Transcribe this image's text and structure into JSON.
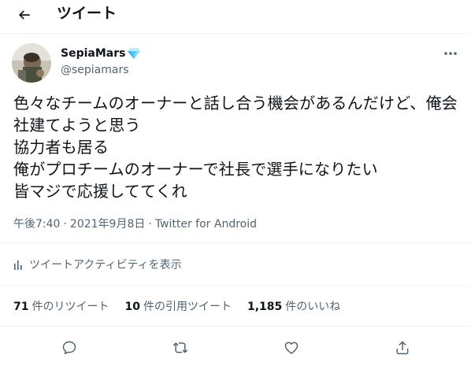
{
  "header": {
    "title": "ツイート",
    "back_icon": "arrow-left-icon"
  },
  "author": {
    "name": "SepiaMars",
    "verified_badge_icon": "diamond-icon",
    "handle": "@sepiamars"
  },
  "tweet": {
    "text": "色々なチームのオーナーと話し合う機会があるんだけど、俺会社建てようと思う\n協力者も居る\n俺がプロチームのオーナーで社長で選手になりたい\n皆マジで応援しててくれ"
  },
  "meta": {
    "time": "午後7:40",
    "separator": "·",
    "date": "2021年9月8日",
    "source": "Twitter for Android"
  },
  "activity": {
    "label": "ツイートアクティビティを表示",
    "icon": "bar-chart-icon"
  },
  "stats": [
    {
      "count": "71",
      "label": "件のリツイート"
    },
    {
      "count": "10",
      "label": "件の引用ツイート"
    },
    {
      "count": "1,185",
      "label": "件のいいね"
    }
  ],
  "actions": {
    "reply_icon": "reply-icon",
    "retweet_icon": "retweet-icon",
    "like_icon": "heart-icon",
    "share_icon": "share-icon"
  },
  "colors": {
    "text": "#0f1419",
    "secondary": "#536471",
    "divider": "#eff3f4",
    "badge": "#5ac8fa"
  }
}
